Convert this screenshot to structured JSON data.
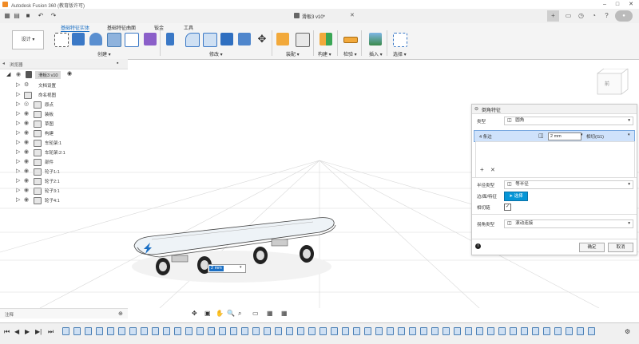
{
  "window": {
    "title": "Autodesk Fusion 360 (教育版许可)",
    "colors": {
      "accent": "#1a6fc4",
      "selection": "#cfe2fb",
      "ok": "#0696d7"
    }
  },
  "document": {
    "tab_label": "滑板3 v10*"
  },
  "toolbar": {
    "design_label": "设计",
    "tabs": [
      "基础特征实体",
      "基础特征曲面",
      "钣金",
      "工具"
    ],
    "groups": [
      "创建",
      "修改",
      "装配",
      "构建",
      "检验",
      "插入",
      "选择"
    ]
  },
  "browser": {
    "header": "浏览器",
    "root": "滑板3 v10",
    "items": [
      "文档设置",
      "命名视图",
      "原点",
      "装板",
      "草图",
      "构建",
      "车轮架:1",
      "车轮架:2:1",
      "部件",
      "轮子1:1",
      "轮子2:1",
      "轮子3:1",
      "轮子4:1"
    ]
  },
  "panel": {
    "title": "倒角特征",
    "type_label": "类型",
    "type_value": "圆角",
    "edge_count": "4 条边",
    "edge_value": "2 mm",
    "continuity": "相切(G1)",
    "radius_type_label": "半径类型",
    "radius_type_value": "等半径",
    "edges_label": "边/面/特征",
    "select_label": "选择",
    "tangent_label": "相切链",
    "corner_label": "拐角类型",
    "corner_value": "滚动连接",
    "ok": "确定",
    "cancel": "取消"
  },
  "viewport": {
    "input_value": "2 mm",
    "viewcube_label": "前"
  },
  "comments": {
    "label": "注释"
  }
}
